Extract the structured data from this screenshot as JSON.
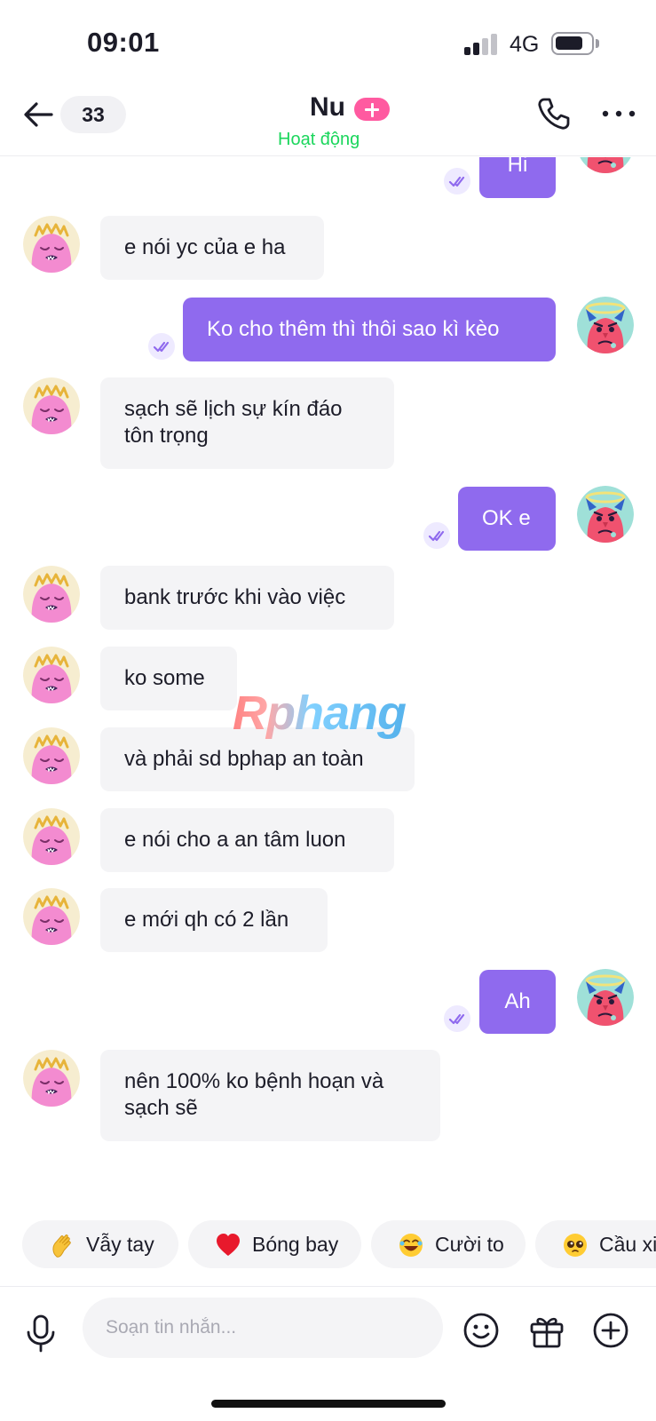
{
  "status_bar": {
    "time": "09:01",
    "network": "4G"
  },
  "header": {
    "back_icon": "arrow-left-icon",
    "unread_count": "33",
    "contact_name": "Nu",
    "status": "Hoạt động",
    "call_icon": "phone-icon",
    "more_icon": "more-dots-icon"
  },
  "messages": [
    {
      "side": "out",
      "text": "Hi"
    },
    {
      "side": "in",
      "text": "e nói yc của e ha"
    },
    {
      "side": "out",
      "text": "Ko cho thêm thì thôi sao kì kèo"
    },
    {
      "side": "in",
      "text": "sạch sẽ lịch sự kín đáo tôn trọng"
    },
    {
      "side": "out",
      "text": "OK e"
    },
    {
      "side": "in",
      "text": "bank trước khi vào việc"
    },
    {
      "side": "in",
      "text": "ko some"
    },
    {
      "side": "in",
      "text": "và phải sd bphap an toàn"
    },
    {
      "side": "in",
      "text": "e nói cho a an tâm luon"
    },
    {
      "side": "in",
      "text": "e mới qh có 2 lần"
    },
    {
      "side": "out",
      "text": "Ah"
    },
    {
      "side": "in",
      "text": "nên 100% ko bệnh hoạn và sạch sẽ"
    }
  ],
  "watermark": "Rphang",
  "quick_reactions": [
    {
      "emoji": "waving-hand-icon",
      "label": "Vẫy tay"
    },
    {
      "emoji": "red-heart-icon",
      "label": "Bóng bay"
    },
    {
      "emoji": "laughing-face-icon",
      "label": "Cười to"
    },
    {
      "emoji": "pleading-face-icon",
      "label": "Cầu xi"
    }
  ],
  "composer": {
    "placeholder": "Soạn tin nhắn...",
    "mic_icon": "microphone-icon",
    "emoji_icon": "smiley-icon",
    "gift_icon": "gift-icon",
    "add_icon": "plus-circle-icon"
  },
  "colors": {
    "outgoing_bubble": "#8f6aee",
    "incoming_bubble": "#f4f4f6",
    "status_active": "#1bd65c",
    "plus_badge": "#ff5aa0"
  }
}
